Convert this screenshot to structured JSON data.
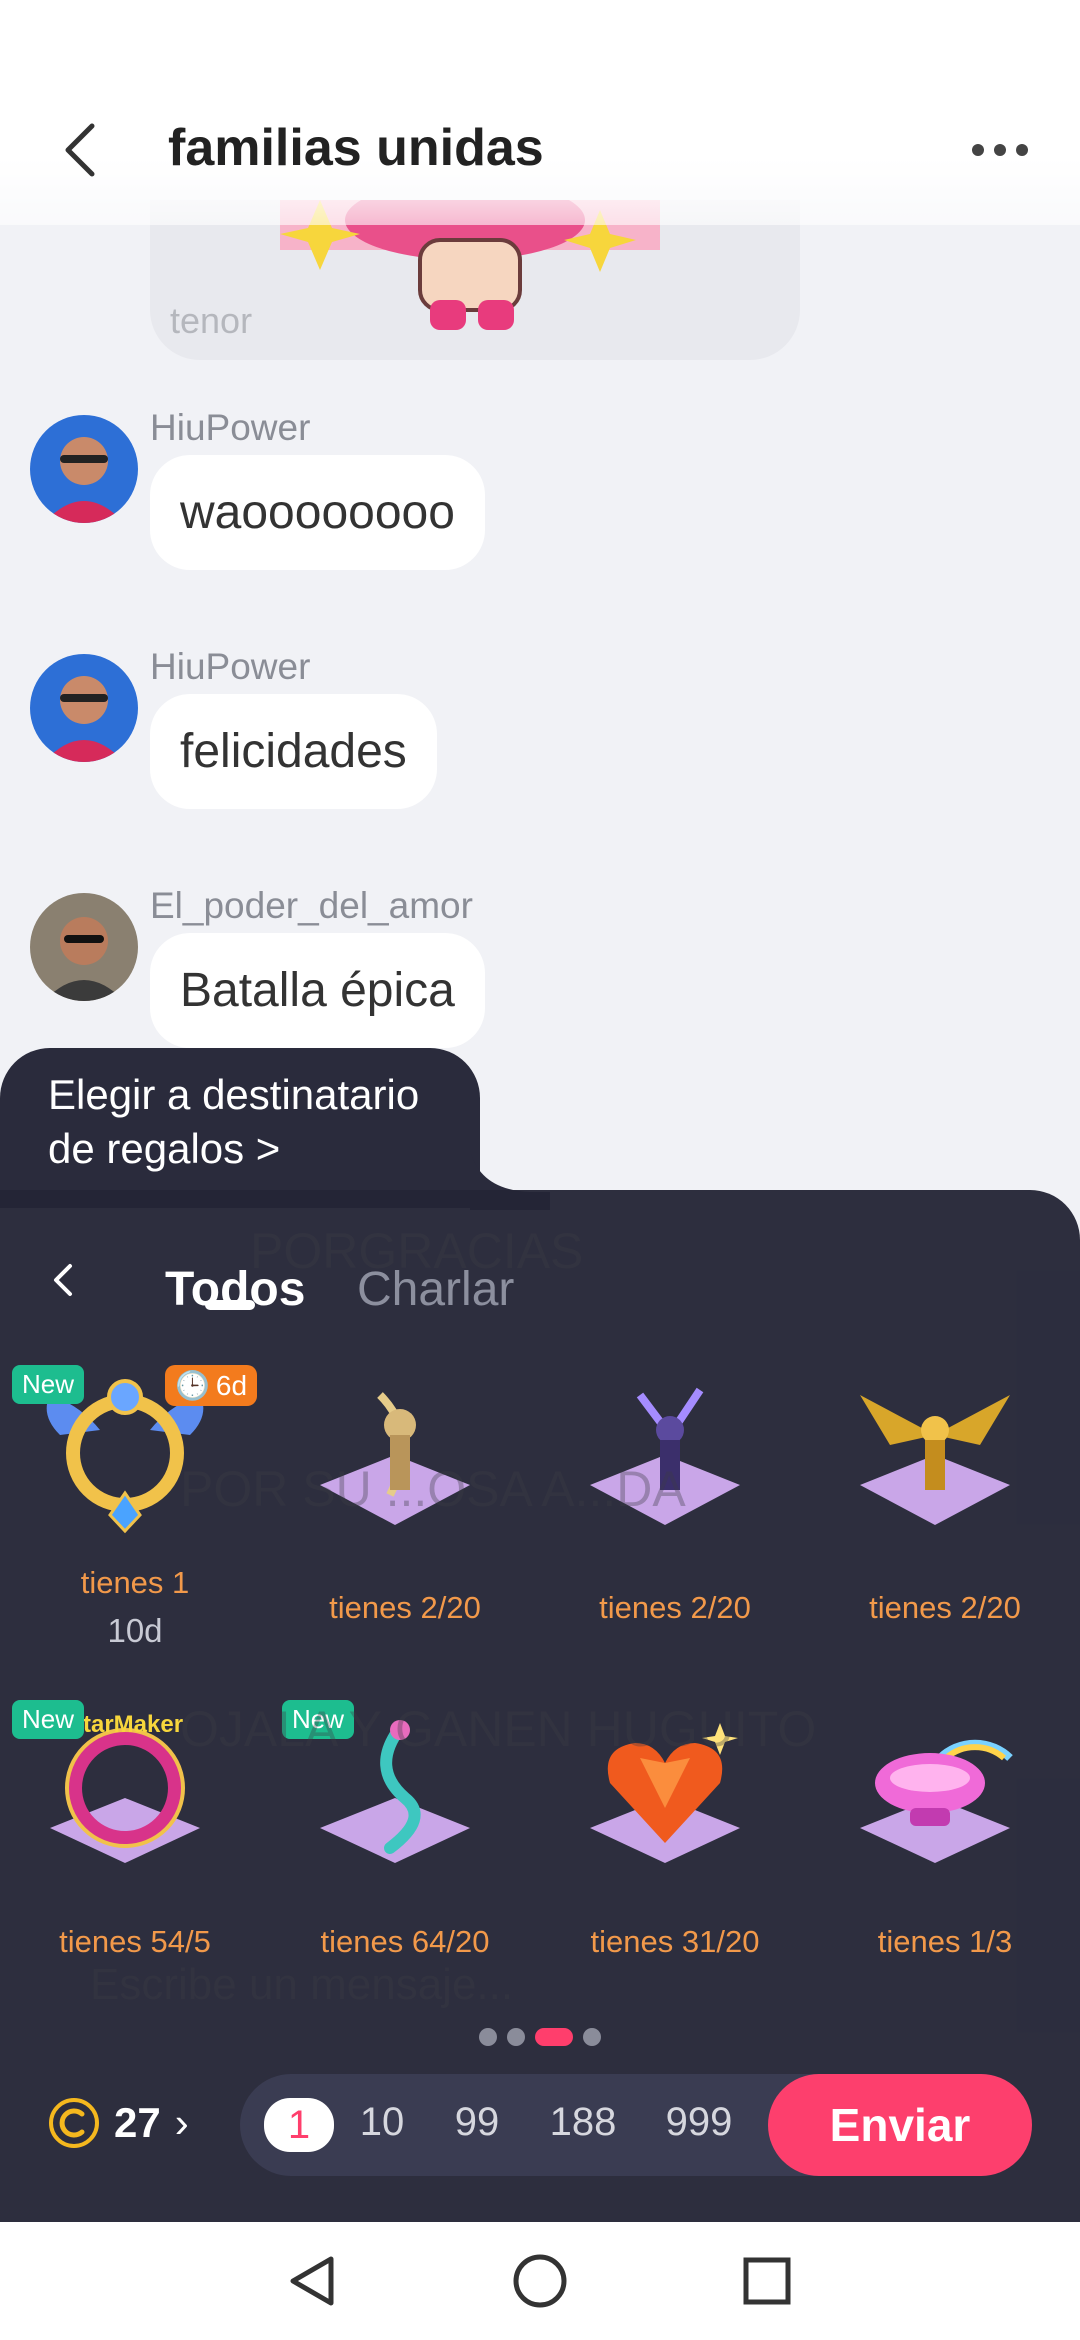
{
  "header": {
    "title": "familias unidas"
  },
  "gif": {
    "provider": "tenor"
  },
  "messages": [
    {
      "sender": "HiuPower",
      "text": "waoooooooo"
    },
    {
      "sender": "HiuPower",
      "text": "felicidades"
    },
    {
      "sender": "El_poder_del_amor",
      "text": "Batalla épica"
    }
  ],
  "background_messages": [
    "PORGRACIAS",
    "POR SU ...OSA A...DA",
    "OJALA Y GANEN HUGUITO",
    "Escribe un mensaje..."
  ],
  "gift_panel": {
    "recipient_label": "Elegir a destinatario de regalos >",
    "tabs": [
      "Todos",
      "Charlar"
    ],
    "active_tab": "Todos",
    "badge_new": "New",
    "gifts": [
      {
        "label": "tienes 1",
        "sub": "10d",
        "new": true,
        "days": "6d"
      },
      {
        "label": "tienes 2/20"
      },
      {
        "label": "tienes 2/20"
      },
      {
        "label": "tienes 2/20"
      },
      {
        "label": "tienes 54/5",
        "new": true,
        "brand": "StarMaker"
      },
      {
        "label": "tienes 64/20",
        "new": true
      },
      {
        "label": "tienes 31/20"
      },
      {
        "label": "tienes 1/3"
      }
    ],
    "page_dots": 4,
    "active_page": 3,
    "coins": "27",
    "quantities": [
      "1",
      "10",
      "99",
      "188",
      "999"
    ],
    "selected_quantity": "1",
    "send_label": "Enviar"
  },
  "colors": {
    "accent": "#fd3f6d",
    "panel_bg": "#242536",
    "gift_label": "#f2994a",
    "new_badge": "#1dbd8f",
    "days_badge": "#f37b1d"
  }
}
